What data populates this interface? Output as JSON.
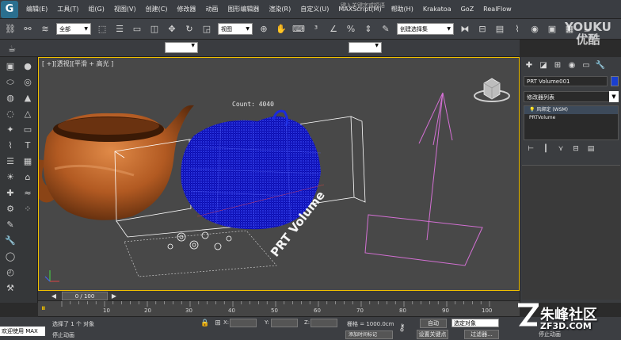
{
  "app": {
    "logo": "G"
  },
  "menu": [
    "编辑(E)",
    "工具(T)",
    "组(G)",
    "视图(V)",
    "创建(C)",
    "修改器",
    "动画",
    "图形编辑器",
    "渲染(R)",
    "自定义(U)",
    "MAXScript(M)",
    "帮助(H)",
    "Krakatoa",
    "GoZ",
    "RealFlow"
  ],
  "search_placeholder": "键入关键字或短语",
  "toolbar": {
    "selection_filter": "全部",
    "reference_coord": "视图",
    "named_selection": "创建选择集"
  },
  "viewport": {
    "label": "[ +][透视][平滑 + 高光 ]",
    "count_label": "Count: 4040",
    "prt_label": "PRT Volume"
  },
  "command_panel": {
    "object_name": "PRT Volume001",
    "object_color": "#1a3fcf",
    "modifier_list": "修改器列表",
    "stack": [
      "风绑定 (WSM)",
      "PRTVolume"
    ]
  },
  "time_slider": {
    "position": "0 / 100",
    "current_frame": 0,
    "total_frames": 100
  },
  "trackbar": {
    "ticks": [
      "10",
      "20",
      "30",
      "40",
      "50",
      "60",
      "70",
      "80",
      "90",
      "100"
    ]
  },
  "status": {
    "welcome": "欢迎使用 MAX",
    "selected": "选择了 1 个 对象",
    "hint": "停止动画",
    "x_label": "X:",
    "y_label": "Y:",
    "z_label": "Z:",
    "grid": "栅格 = 1000.0cm",
    "add_time_tag": "添加时间标记",
    "auto_key": "自动",
    "set_key": "设置关键点",
    "key_filter_selected": "选定对象",
    "key_filters": "过滤器..."
  },
  "watermarks": {
    "youku_line1": "YOUKU",
    "youku_line2": "优酷",
    "zf3d_cn": "朱峰社区",
    "zf3d_url": "ZF3D.COM",
    "stop_anim": "停止动画"
  }
}
